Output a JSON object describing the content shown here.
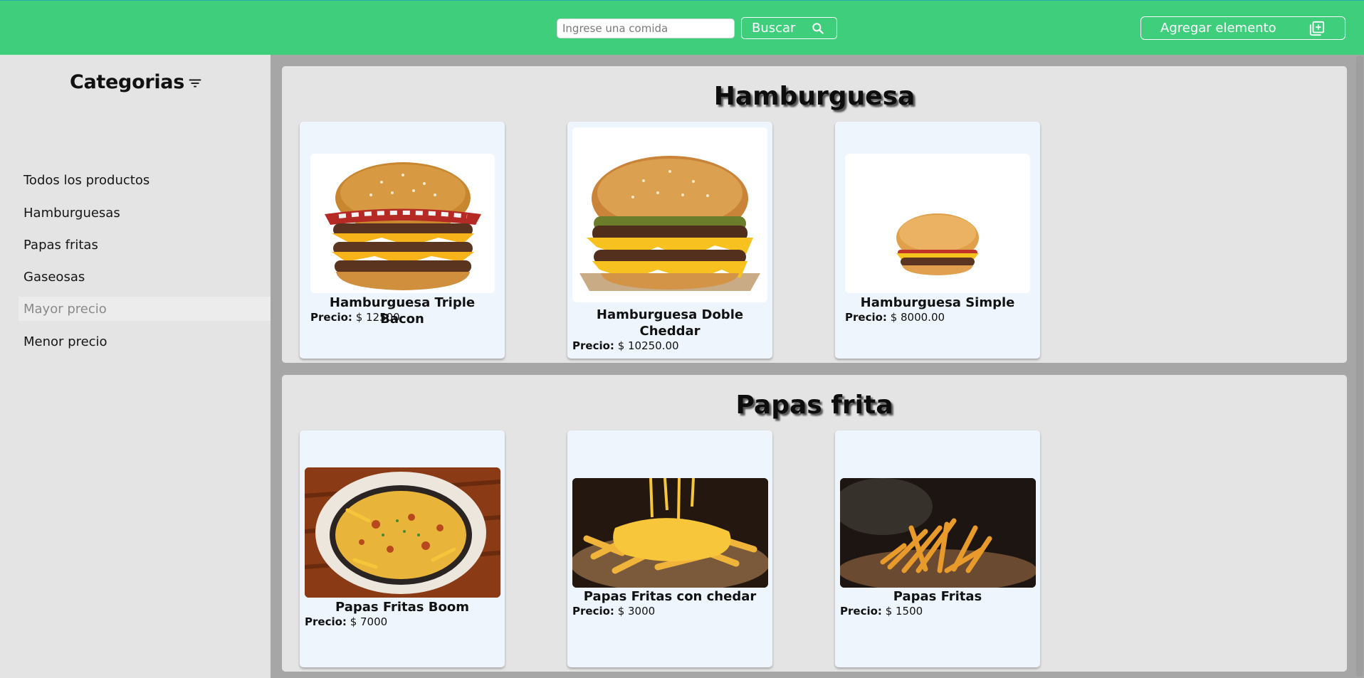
{
  "header": {
    "search_placeholder": "Ingrese una comida",
    "search_button": "Buscar",
    "search_icon": "search-icon",
    "add_button": "Agregar elemento",
    "add_icon": "add-box-icon",
    "bg_color": "#3fce7c"
  },
  "sidebar": {
    "title": "Categorias",
    "filter_icon": "filter-icon",
    "items": [
      {
        "label": "Todos los productos"
      },
      {
        "label": "Hamburguesas"
      },
      {
        "label": "Papas fritas"
      },
      {
        "label": "Gaseosas"
      },
      {
        "label": "Mayor precio",
        "active": true
      },
      {
        "label": "Menor precio"
      }
    ]
  },
  "sections": [
    {
      "title": "Hamburguesa",
      "products": [
        {
          "name": "Hamburguesa Triple Bacon",
          "price_label": "Precio:",
          "price": "$ 12500",
          "image": "triple-bacon-burger"
        },
        {
          "name": "Hamburguesa Doble Cheddar",
          "price_label": "Precio:",
          "price": "$ 10250.00",
          "image": "double-cheddar-burger"
        },
        {
          "name": "Hamburguesa Simple",
          "price_label": "Precio:",
          "price": "$ 8000.00",
          "image": "simple-burger"
        }
      ]
    },
    {
      "title": "Papas frita",
      "products": [
        {
          "name": "Papas Fritas Boom",
          "price_label": "Precio:",
          "price": "$ 7000",
          "image": "loaded-fries"
        },
        {
          "name": "Papas Fritas con chedar",
          "price_label": "Precio:",
          "price": "$ 3000",
          "image": "cheddar-fries"
        },
        {
          "name": "Papas Fritas",
          "price_label": "Precio:",
          "price": "$ 1500",
          "image": "plain-fries"
        }
      ]
    }
  ]
}
